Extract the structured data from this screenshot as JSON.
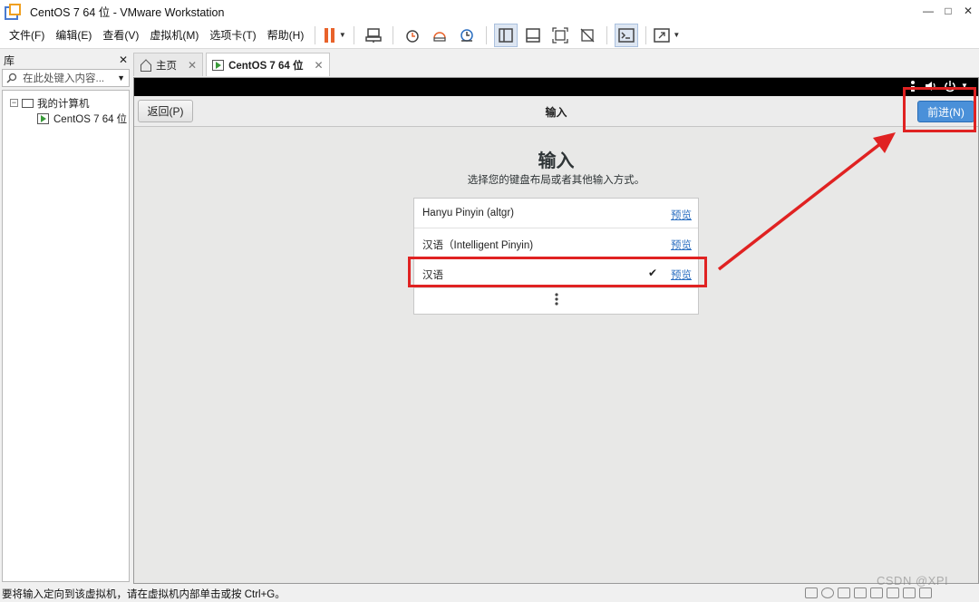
{
  "window": {
    "title": "CentOS 7 64 位 - VMware Workstation",
    "controls": [
      "—",
      "□",
      "✕"
    ]
  },
  "menu": [
    "文件(F)",
    "编辑(E)",
    "查看(V)",
    "虚拟机(M)",
    "选项卡(T)",
    "帮助(H)"
  ],
  "library": {
    "title": "库",
    "close": "✕",
    "search_placeholder": "在此处键入内容...",
    "tree": {
      "root": "我的计算机",
      "child": "CentOS 7 64 位"
    }
  },
  "tabs": [
    {
      "label": "主页"
    },
    {
      "label": "CentOS 7 64 位"
    }
  ],
  "installer": {
    "back_label": "返回(P)",
    "header_title": "输入",
    "next_label": "前进(N)",
    "title": "输入",
    "subtitle": "选择您的键盘布局或者其他输入方式。",
    "layouts": [
      {
        "name": "Hanyu Pinyin (altgr)",
        "preview": "预览",
        "selected": false
      },
      {
        "name": "汉语（Intelligent Pinyin)",
        "preview": "预览",
        "selected": false
      },
      {
        "name": "汉语",
        "preview": "预览",
        "selected": true
      }
    ],
    "check_mark": "✔",
    "more": "⋮"
  },
  "status": {
    "text": "要将输入定向到该虚拟机，请在虚拟机内部单击或按 Ctrl+G。"
  },
  "watermark": "CSDN @XPI",
  "colors": {
    "accent_button": "#4a90d9",
    "annotation_red": "#e02222",
    "pause_orange": "#e8622a"
  }
}
